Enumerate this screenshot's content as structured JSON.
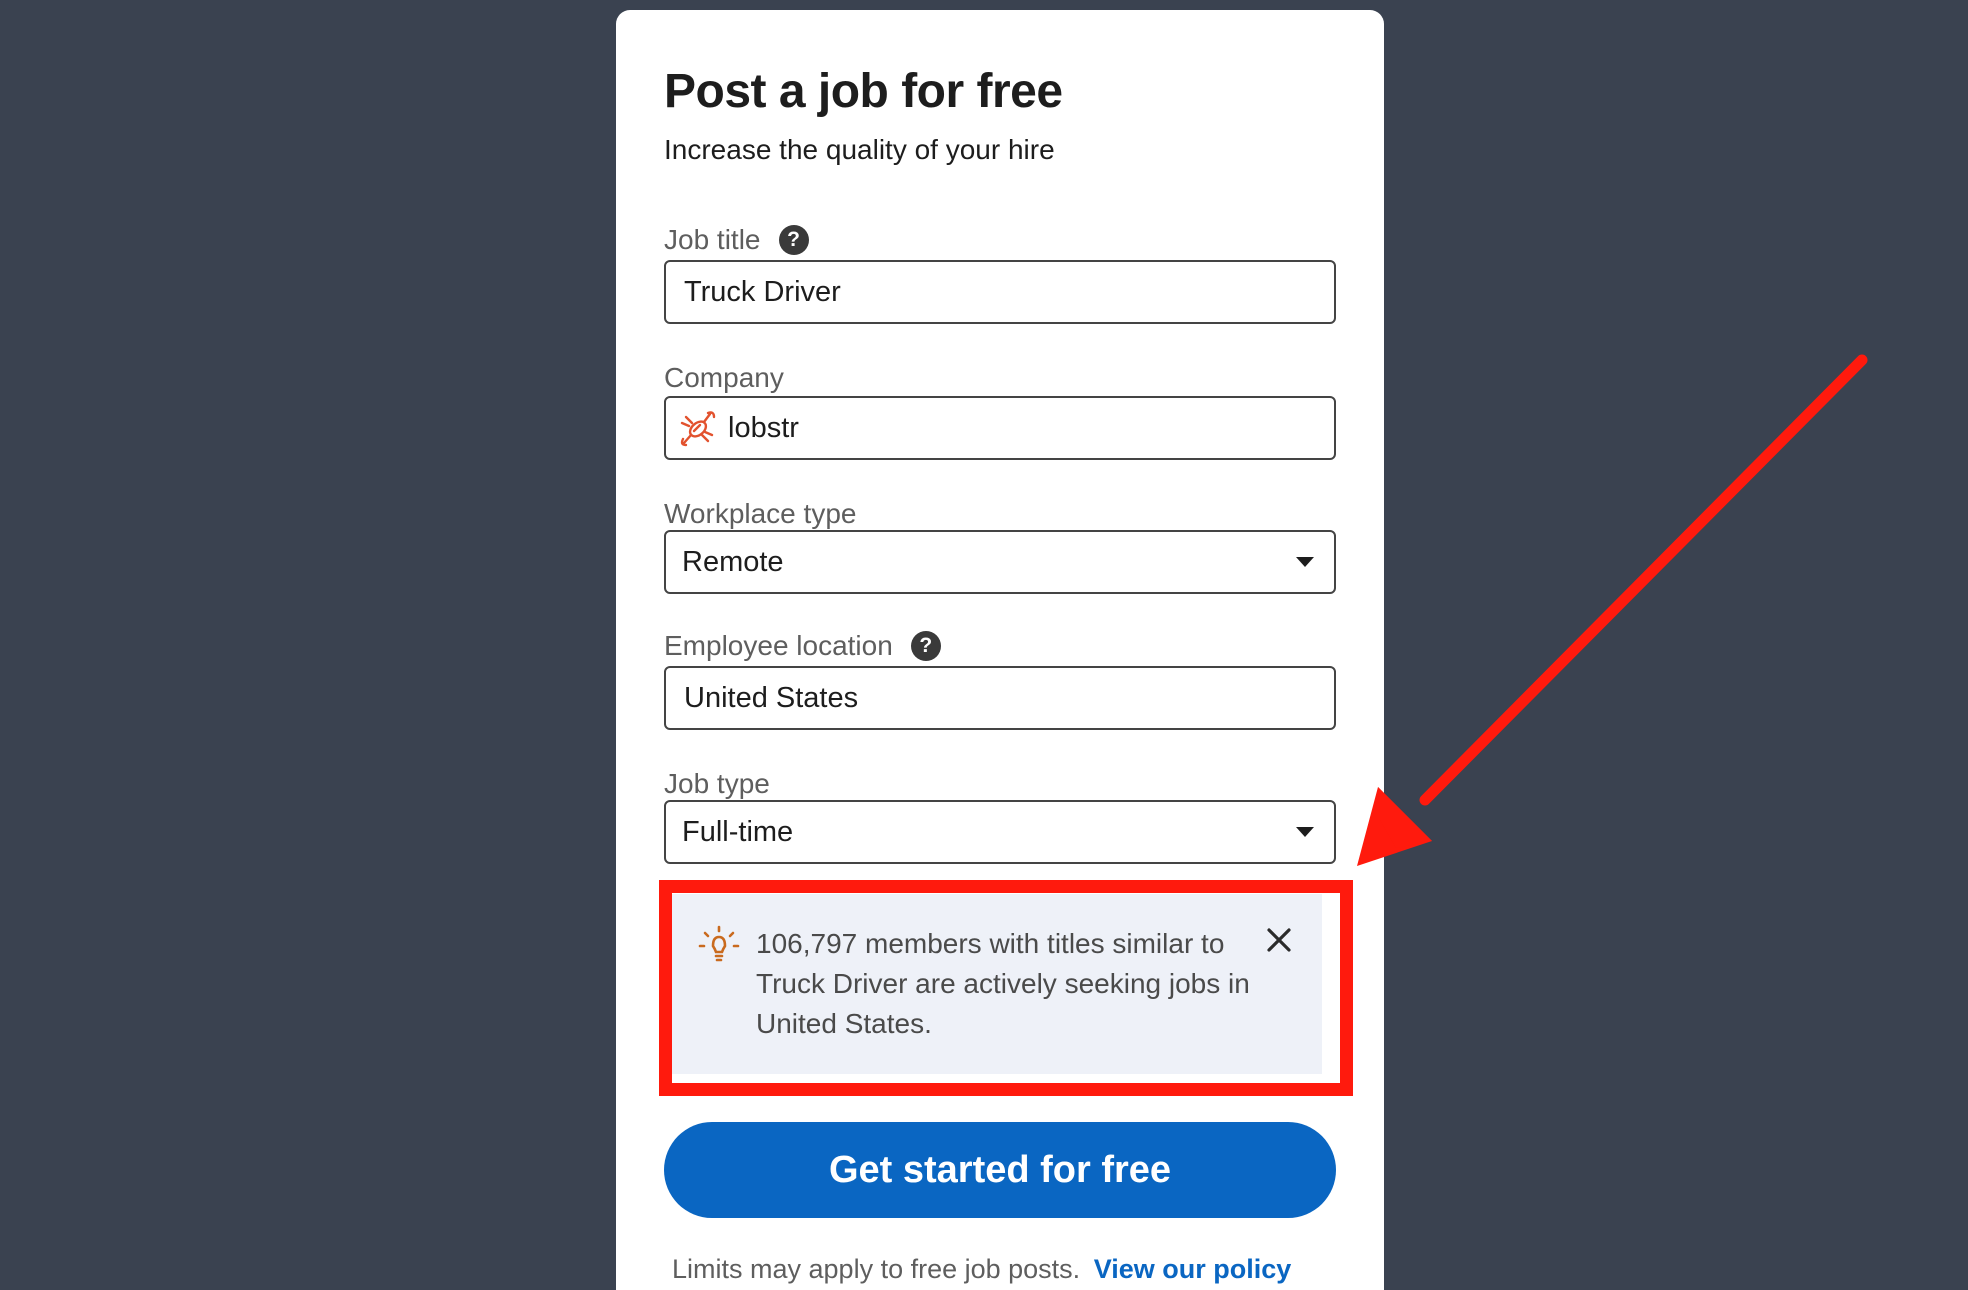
{
  "form": {
    "title": "Post a job for free",
    "subtitle": "Increase the quality of your hire",
    "job_title": {
      "label": "Job title",
      "value": "Truck Driver"
    },
    "company": {
      "label": "Company",
      "value": "lobstr"
    },
    "workplace_type": {
      "label": "Workplace type",
      "value": "Remote"
    },
    "employee_location": {
      "label": "Employee location",
      "value": "United States"
    },
    "job_type": {
      "label": "Job type",
      "value": "Full-time"
    }
  },
  "notice": {
    "text": "106,797 members with titles similar to Truck Driver are actively seeking jobs in United States."
  },
  "cta": {
    "label": "Get started for free"
  },
  "footer": {
    "text": "Limits may apply to free job posts.",
    "link": "View our policy"
  },
  "colors": {
    "background": "#3a4250",
    "primary": "#0a66c2",
    "annotation_red": "#ff1a0d",
    "notice_bg": "#eef1f8"
  },
  "icons": [
    "help-icon",
    "lobster-logo-icon",
    "chevron-down-icon",
    "lightbulb-icon",
    "close-icon",
    "annotation-arrow"
  ]
}
